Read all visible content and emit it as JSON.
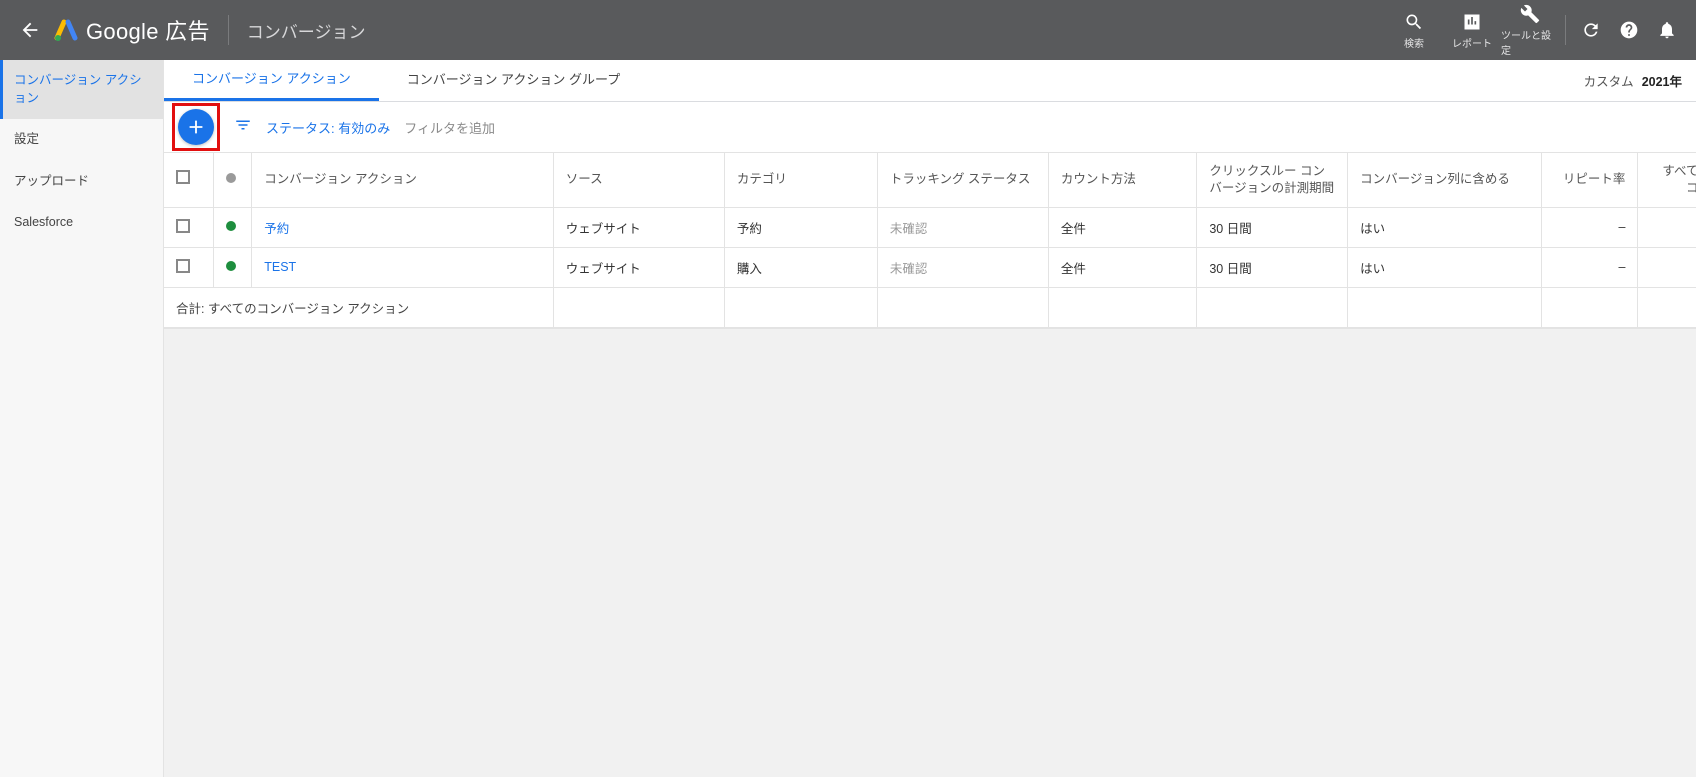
{
  "header": {
    "brand_google": "Google",
    "brand_ads": "広告",
    "page_title": "コンバージョン",
    "tool_search": "検索",
    "tool_reports": "レポート",
    "tool_tools": "ツールと設定"
  },
  "leftnav": {
    "items": [
      {
        "label": "コンバージョン アクション",
        "active": true
      },
      {
        "label": "設定"
      },
      {
        "label": "アップロード"
      },
      {
        "label": "Salesforce"
      }
    ]
  },
  "tabs": {
    "items": [
      {
        "label": "コンバージョン アクション",
        "active": true
      },
      {
        "label": "コンバージョン アクション グループ"
      }
    ],
    "daterange_label": "カスタム",
    "daterange_value": "2021年"
  },
  "filters": {
    "status_chip": "ステータス: 有効のみ",
    "add_filter": "フィルタを追加"
  },
  "table": {
    "columns": {
      "action": "コンバージョン アクション",
      "source": "ソース",
      "category": "カテゴリ",
      "tracking": "トラッキング ステータス",
      "count": "カウント方法",
      "window": "クリックスルー コンバージョンの計測期間",
      "include": "コンバージョン列に含める",
      "repeat": "リピート率",
      "allconv": "すべてのコン"
    },
    "rows": [
      {
        "status": "green",
        "action": "予約",
        "source": "ウェブサイト",
        "category": "予約",
        "tracking": "未確認",
        "count": "全件",
        "window": "30 日間",
        "include": "はい",
        "repeat": "–"
      },
      {
        "status": "green",
        "action": "TEST",
        "source": "ウェブサイト",
        "category": "購入",
        "tracking": "未確認",
        "count": "全件",
        "window": "30 日間",
        "include": "はい",
        "repeat": "–"
      }
    ],
    "totals_label": "合計: すべてのコンバージョン アクション"
  }
}
